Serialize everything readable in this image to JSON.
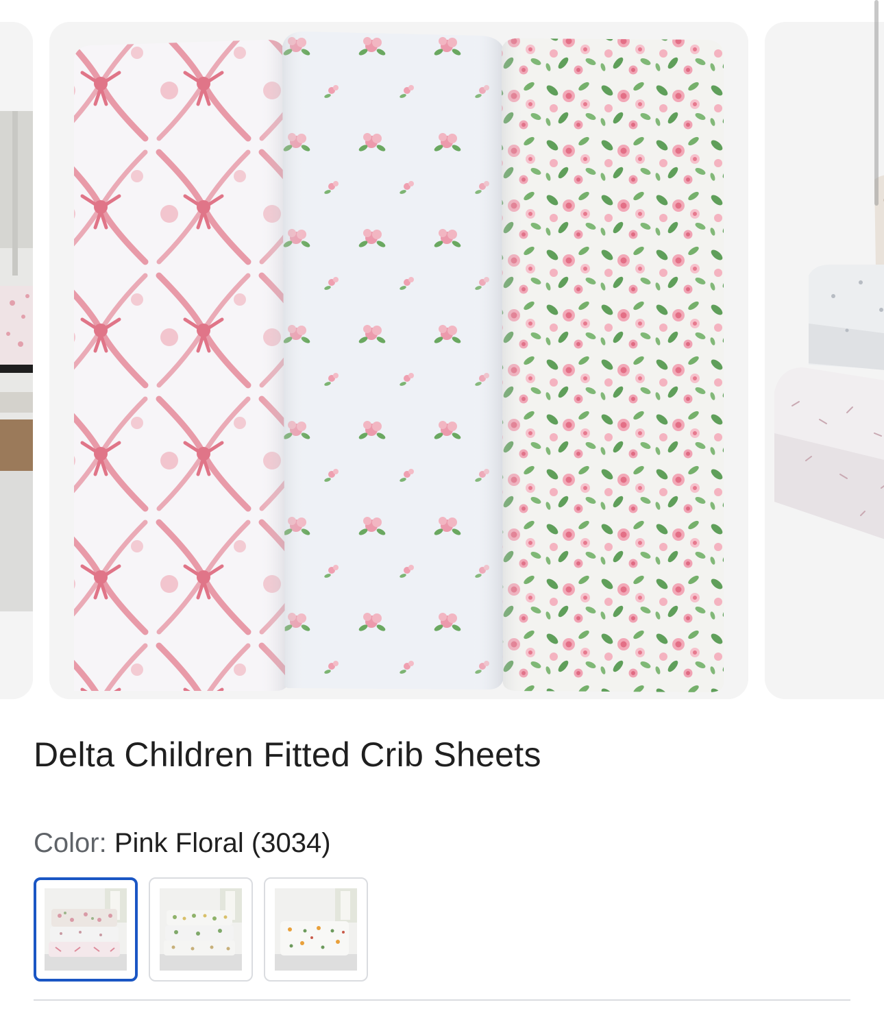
{
  "product": {
    "title": "Delta Children Fitted Crib Sheets",
    "color_label": "Color:",
    "color_value": "Pink Floral (3034)"
  },
  "swatches": [
    {
      "name": "Pink Floral (3034)",
      "selected": true
    },
    {
      "name": "variant-2",
      "selected": false
    },
    {
      "name": "variant-3",
      "selected": false
    }
  ],
  "colors": {
    "selected_border": "#1a56c4",
    "swatch_border": "#dadce0",
    "card_bg": "#f4f4f4",
    "fabric_pink": "#e27a8c",
    "leaf_green": "#6aa860"
  }
}
